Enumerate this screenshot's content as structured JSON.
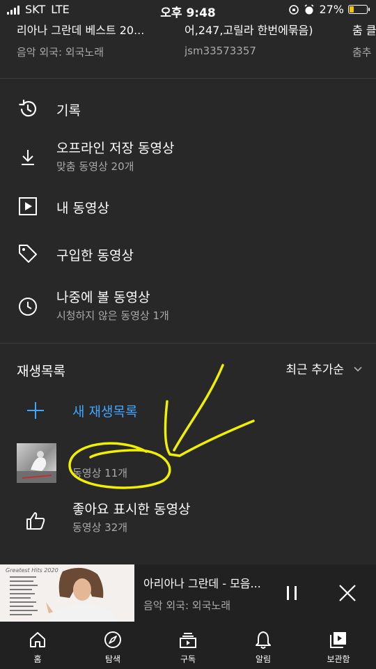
{
  "status": {
    "carrier": "SKT",
    "network": "LTE",
    "time": "오후 9:48",
    "battery": "27%",
    "battery_level": 0.27
  },
  "recent": [
    {
      "title": "리아나 그란데 베스트 20...",
      "subtitle": "음악 외국: 외국노래"
    },
    {
      "title": "어,247,고릴라 한번에묶음)",
      "subtitle": "jsm33573357"
    },
    {
      "title": "춤 클",
      "subtitle": "춤추"
    }
  ],
  "menu": {
    "history": {
      "title": "기록",
      "icon": "history-icon"
    },
    "downloads": {
      "title": "오프라인 저장 동영상",
      "sub": "맞춤 동영상 20개",
      "icon": "download-icon"
    },
    "my_videos": {
      "title": "내 동영상",
      "icon": "play-box-icon"
    },
    "purchases": {
      "title": "구입한 동영상",
      "icon": "tag-icon"
    },
    "watch_later": {
      "title": "나중에 볼 동영상",
      "sub": "시청하지 않은 동영상 1개",
      "icon": "clock-icon"
    }
  },
  "playlists": {
    "header": "재생목록",
    "sort_label": "최근 추가순",
    "new_label": "새 재생목록",
    "items": [
      {
        "title": "",
        "sub": "동영상 11개"
      },
      {
        "title": "좋아요 표시한 동영상",
        "sub": "동영상 32개",
        "icon": "thumb-up-icon"
      }
    ]
  },
  "mini_player": {
    "title": "아리아나 그란데  - 모음...",
    "subtitle": "음악 외국: 외국노래",
    "art_caption": "Greatest Hits 2020"
  },
  "tabs": [
    {
      "label": "홈",
      "icon": "home-icon"
    },
    {
      "label": "탐색",
      "icon": "explore-icon"
    },
    {
      "label": "구독",
      "icon": "subscriptions-icon"
    },
    {
      "label": "알림",
      "icon": "bell-icon"
    },
    {
      "label": "보관함",
      "icon": "library-icon"
    }
  ],
  "colors": {
    "background": "#282828",
    "accent_blue": "#3ea6ff",
    "annotation_yellow": "#f0f000"
  }
}
